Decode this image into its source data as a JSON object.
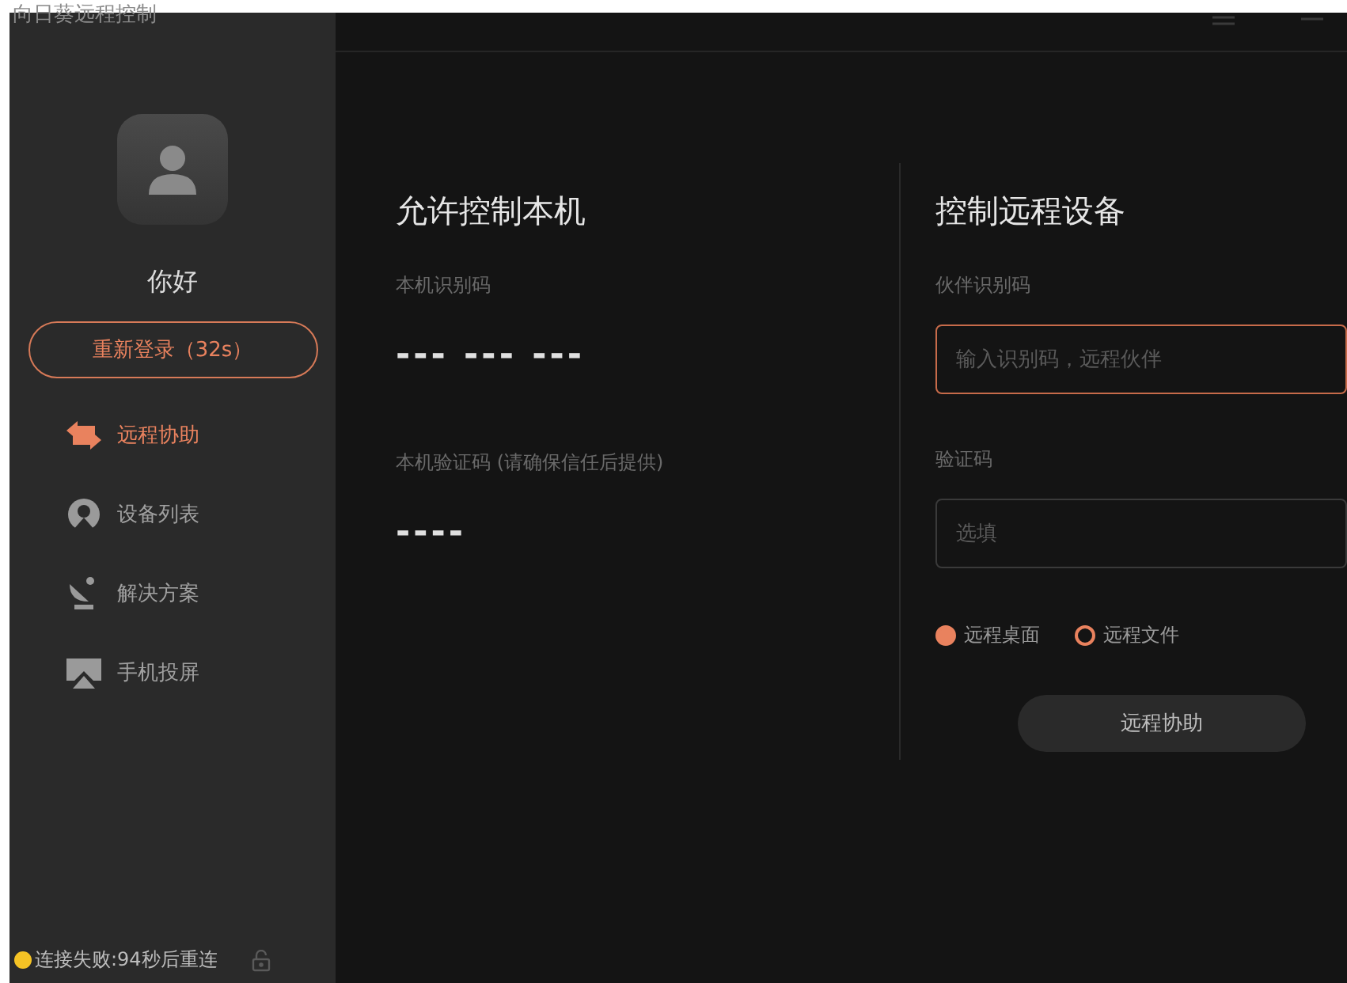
{
  "app": {
    "title": "向日葵远程控制"
  },
  "user": {
    "greeting": "你好",
    "relogin_button": "重新登录（32s）"
  },
  "nav": [
    {
      "label": "远程协助",
      "kind": "swap",
      "selected": true
    },
    {
      "label": "设备列表",
      "kind": "device",
      "selected": false
    },
    {
      "label": "解决方案",
      "kind": "dish",
      "selected": false
    },
    {
      "label": "手机投屏",
      "kind": "cast",
      "selected": false
    }
  ],
  "status": {
    "text": "连接失败:94秒后重连",
    "color": "#f5c325"
  },
  "allow_panel": {
    "title": "允许控制本机",
    "fields": [
      {
        "label": "本机识别码",
        "value": "--- --- ---"
      },
      {
        "label": "本机验证码 (请确保信任后提供)",
        "value": "----"
      }
    ]
  },
  "control_panel": {
    "title": "控制远程设备",
    "fields": [
      {
        "label": "伙伴识别码",
        "placeholder": "输入识别码，远程伙伴",
        "focused": true
      },
      {
        "label": "验证码",
        "placeholder": "选填",
        "focused": false
      }
    ],
    "modes": [
      {
        "label": "远程桌面",
        "selected": true
      },
      {
        "label": "远程文件",
        "selected": false
      }
    ],
    "button": "远程协助"
  }
}
